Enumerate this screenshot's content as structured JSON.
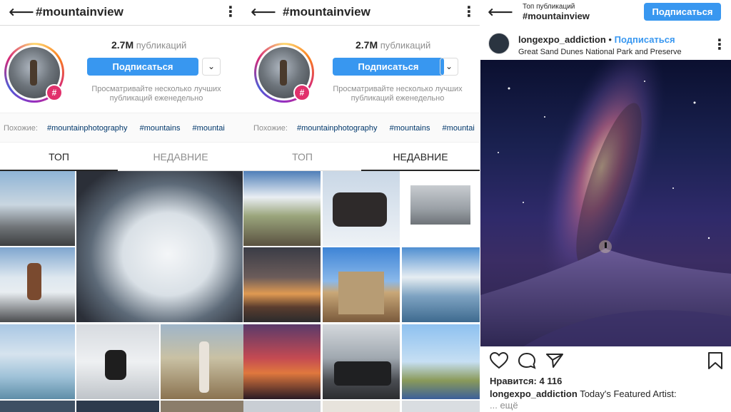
{
  "panel1": {
    "title": "#mountainview",
    "count_value": "2.7M",
    "count_label": "публикаций",
    "follow_label": "Подписаться",
    "hint": "Просматривайте несколько лучших публикаций еженедельно",
    "similar_label": "Похожие:",
    "similar_tags": [
      "#mountainphotography",
      "#mountains",
      "#mountai"
    ],
    "tabs": [
      {
        "label": "ТОП",
        "active": true
      },
      {
        "label": "НЕДАВНИЕ",
        "active": false
      }
    ]
  },
  "panel2": {
    "title": "#mountainview",
    "count_value": "2.7M",
    "count_label": "публикаций",
    "follow_label": "Подписаться",
    "hint": "Просматривайте несколько лучших публикаций еженедельно",
    "similar_label": "Похожие:",
    "similar_tags": [
      "#mountainphotography",
      "#mountains",
      "#mountai"
    ],
    "tabs": [
      {
        "label": "ТОП",
        "active": false
      },
      {
        "label": "НЕДАВНИЕ",
        "active": true
      }
    ]
  },
  "panel3": {
    "header_small": "Топ публикаций",
    "header_title": "#mountainview",
    "follow_label": "Подписаться",
    "post_user": "longexpo_addiction",
    "post_separator": "•",
    "post_follow": "Подписаться",
    "post_location": "Great Sand Dunes National Park and Preserve",
    "likes_label": "Нравится:",
    "likes_count": "4 116",
    "caption_user": "longexpo_addiction",
    "caption_text": "Today's Featured Artist:",
    "more": "... ещё"
  },
  "icons": {
    "back": "back-arrow-icon",
    "more": "more-vertical-icon",
    "chevron": "chevron-down-icon",
    "hashtag": "hashtag-badge-icon",
    "like": "heart-icon",
    "comment": "comment-icon",
    "share": "share-icon",
    "save": "bookmark-icon"
  },
  "colors": {
    "accent": "#3897f0",
    "text": "#262626",
    "muted": "#8e8e8e",
    "link": "#00376b"
  }
}
